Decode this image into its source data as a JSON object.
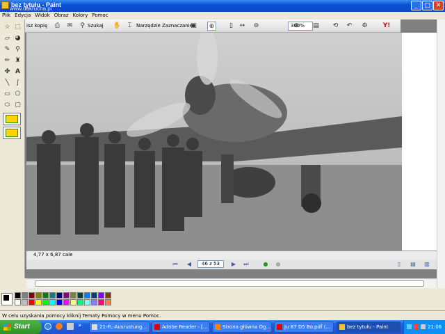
{
  "window": {
    "title": "bez tytułu - Paint",
    "watermark": "www.dakrucha.pl"
  },
  "menu": [
    "Plik",
    "Edycja",
    "Widok",
    "Obraz",
    "Kolory",
    "Pomoc"
  ],
  "acrobat_toolbar": {
    "save_copy_label": "isz kopię",
    "search_label": "Szukaj",
    "select_tool_label": "Narzędzie Zaznaczanie",
    "zoom_value": "300%"
  },
  "page_size_label": "4,77 x 6,87 cale",
  "navigation": {
    "page_indicator": "46 z 53"
  },
  "palette_colors": [
    "#000000",
    "#808080",
    "#800000",
    "#808000",
    "#008000",
    "#008080",
    "#000080",
    "#800080",
    "#808040",
    "#004040",
    "#0080ff",
    "#004080",
    "#8000ff",
    "#804000",
    "#ffffff",
    "#c0c0c0",
    "#ff0000",
    "#ffff00",
    "#00ff00",
    "#00ffff",
    "#0000ff",
    "#ff00ff",
    "#ffff80",
    "#00ff80",
    "#80ffff",
    "#8080ff",
    "#ff0080",
    "#ff8040"
  ],
  "status_text": "W celu uzyskania pomocy kliknij Tematy Pomocy w menu Pomoc.",
  "taskbar": {
    "start_label": "Start",
    "tasks": [
      {
        "label": "21-FL-Ausrustung...",
        "active": false
      },
      {
        "label": "Adobe Reader - [...",
        "active": false
      },
      {
        "label": "Strona główna Og...",
        "active": false
      },
      {
        "label": "Ju 87 D5 Bo.pdf (...",
        "active": false
      },
      {
        "label": "bez tytułu - Paint",
        "active": true
      }
    ],
    "clock": "21:06"
  }
}
